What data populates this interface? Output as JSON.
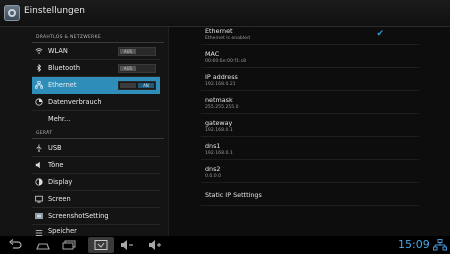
{
  "window": {
    "title": "Einstellungen",
    "app_icon": "settings-icon"
  },
  "sidebar": {
    "sections": [
      {
        "header": "DRAHTLOS & NETZWERKE",
        "items": [
          {
            "label": "WLAN",
            "icon": "wifi-icon",
            "toggle": "AUS",
            "selected": false
          },
          {
            "label": "Bluetooth",
            "icon": "bluetooth-icon",
            "toggle": "AUS",
            "selected": false
          },
          {
            "label": "Ethernet",
            "icon": "ethernet-icon",
            "toggle": "AN",
            "selected": true
          },
          {
            "label": "Datenverbrauch",
            "icon": "data-usage-icon",
            "selected": false
          },
          {
            "label": "Mehr...",
            "icon": "",
            "selected": false
          }
        ]
      },
      {
        "header": "GERÄT",
        "items": [
          {
            "label": "USB",
            "icon": "usb-icon"
          },
          {
            "label": "Töne",
            "icon": "sound-icon"
          },
          {
            "label": "Display",
            "icon": "display-icon"
          },
          {
            "label": "Screen",
            "icon": "screen-icon"
          },
          {
            "label": "ScreenshotSetting",
            "icon": "screenshot-icon"
          },
          {
            "label": "Speicher",
            "icon": "storage-icon"
          }
        ]
      }
    ]
  },
  "main": {
    "ethernet": {
      "label": "Ethernet",
      "status": "Ethernet is enabled",
      "checked": true
    },
    "details": [
      {
        "key": "MAC",
        "value": "00:60:6e:00:f1:c8"
      },
      {
        "key": "IP address",
        "value": "192.168.0.21"
      },
      {
        "key": "netmask",
        "value": "255.255.255.0"
      },
      {
        "key": "gateway",
        "value": "192.168.0.1"
      },
      {
        "key": "dns1",
        "value": "192.168.0.1"
      },
      {
        "key": "dns2",
        "value": "0.0.0.0"
      }
    ],
    "static_ip_label": "Static IP Setttings"
  },
  "navbar": {
    "time": "15:09",
    "icons": [
      "back-icon",
      "home-icon",
      "recent-apps-icon",
      "screenshot-icon",
      "volume-down-icon",
      "volume-up-icon"
    ],
    "status_icon": "ethernet-status-icon",
    "accent": "#4aa6e6"
  },
  "colors": {
    "selected": "#2f8dba",
    "check": "#2f9ad6"
  }
}
